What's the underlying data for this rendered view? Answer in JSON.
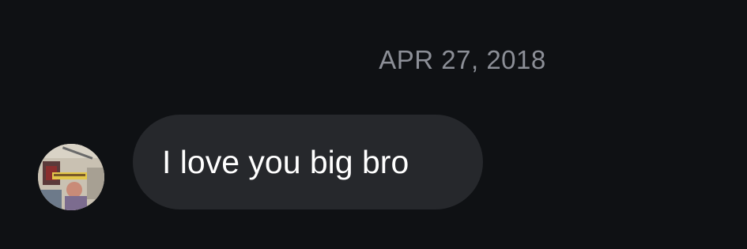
{
  "thread": {
    "date_header": "APR 27, 2018"
  },
  "messages": [
    {
      "direction": "incoming",
      "text": "I love you big bro",
      "avatar_icon": "contact-avatar-photo"
    }
  ],
  "colors": {
    "background": "#0f1114",
    "bubble_incoming": "#26282c",
    "date_text": "#8c8f97",
    "message_text": "#ffffff"
  }
}
